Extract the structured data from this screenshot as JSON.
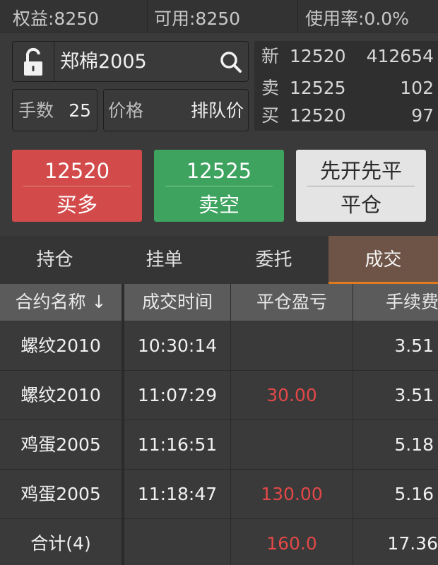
{
  "account": {
    "equity": "权益:8250",
    "available": "可用:8250",
    "usage": "使用率:0.0%"
  },
  "order_form": {
    "lock_icon": "unlock-icon",
    "instrument": "郑棉2005",
    "search_icon": "search-icon",
    "qty_label": "手数",
    "qty_value": "25",
    "price_label": "价格",
    "price_value": "排队价"
  },
  "quote": {
    "last_label": "新",
    "last_price": "12520",
    "volume": "412654",
    "ask_label": "卖",
    "ask_price": "12525",
    "ask_qty": "102",
    "bid_label": "买",
    "bid_price": "12520",
    "bid_qty": "97"
  },
  "actions": {
    "buy_price": "12520",
    "buy_label": "买多",
    "sell_price": "12525",
    "sell_label": "卖空",
    "close_mode": "先开先平",
    "close_label": "平仓"
  },
  "tabs": [
    {
      "label": "持仓",
      "active": false
    },
    {
      "label": "挂单",
      "active": false
    },
    {
      "label": "委托",
      "active": false
    },
    {
      "label": "成交",
      "active": true
    }
  ],
  "table": {
    "headers": [
      "合约名称 ↓",
      "成交时间",
      "平仓盈亏",
      "手续费"
    ],
    "rows": [
      {
        "contract": "螺纹2010",
        "time": "10:30:14",
        "pnl": "",
        "fee": "3.51"
      },
      {
        "contract": "螺纹2010",
        "time": "11:07:29",
        "pnl": "30.00",
        "fee": "3.51"
      },
      {
        "contract": "鸡蛋2005",
        "time": "11:16:51",
        "pnl": "",
        "fee": "5.18"
      },
      {
        "contract": "鸡蛋2005",
        "time": "11:18:47",
        "pnl": "130.00",
        "fee": "5.16"
      }
    ],
    "total": {
      "contract": "合计(4)",
      "time": "",
      "pnl": "160.0",
      "fee": "17.36"
    }
  },
  "colors": {
    "buy": "#d24a4a",
    "sell": "#3ea35f",
    "loss_profit_text": "#e24848",
    "active_tab": "#6e5446",
    "active_tab_underline": "#e07a1f"
  }
}
